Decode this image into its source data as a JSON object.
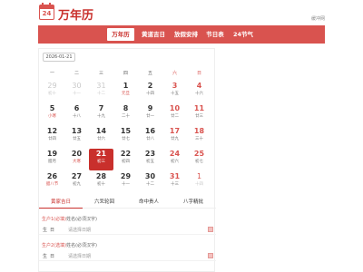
{
  "header": {
    "logo_text": "24",
    "title": "万年历",
    "top_right": "缓冲网"
  },
  "nav": [
    {
      "label": "万年历",
      "active": true
    },
    {
      "label": "黄道吉日",
      "active": false
    },
    {
      "label": "放假安排",
      "active": false
    },
    {
      "label": "节日表",
      "active": false
    },
    {
      "label": "24节气",
      "active": false
    }
  ],
  "date_input": "2026-01-21",
  "weekdays": [
    "一",
    "二",
    "三",
    "四",
    "五",
    "六",
    "日"
  ],
  "calendar": [
    [
      {
        "d": "29",
        "l": "初十",
        "m": true
      },
      {
        "d": "30",
        "l": "十一",
        "m": true
      },
      {
        "d": "31",
        "l": "十二",
        "m": true
      },
      {
        "d": "1",
        "l": "元旦",
        "r": true
      },
      {
        "d": "2",
        "l": "十四"
      },
      {
        "d": "3",
        "l": "十五"
      },
      {
        "d": "4",
        "l": "十六"
      }
    ],
    [
      {
        "d": "5",
        "l": "小寒",
        "r": true
      },
      {
        "d": "6",
        "l": "十八"
      },
      {
        "d": "7",
        "l": "十九"
      },
      {
        "d": "8",
        "l": "二十"
      },
      {
        "d": "9",
        "l": "廿一"
      },
      {
        "d": "10",
        "l": "廿二"
      },
      {
        "d": "11",
        "l": "廿三"
      }
    ],
    [
      {
        "d": "12",
        "l": "廿四"
      },
      {
        "d": "13",
        "l": "廿五"
      },
      {
        "d": "14",
        "l": "廿六"
      },
      {
        "d": "15",
        "l": "廿七"
      },
      {
        "d": "16",
        "l": "廿八"
      },
      {
        "d": "17",
        "l": "廿九"
      },
      {
        "d": "18",
        "l": "三十"
      }
    ],
    [
      {
        "d": "19",
        "l": "腊月"
      },
      {
        "d": "20",
        "l": "大寒",
        "r": true
      },
      {
        "d": "21",
        "l": "初三",
        "today": true
      },
      {
        "d": "22",
        "l": "初四"
      },
      {
        "d": "23",
        "l": "初五"
      },
      {
        "d": "24",
        "l": "初六"
      },
      {
        "d": "25",
        "l": "初七"
      }
    ],
    [
      {
        "d": "26",
        "l": "腊八节",
        "r": true
      },
      {
        "d": "27",
        "l": "初九"
      },
      {
        "d": "28",
        "l": "初十"
      },
      {
        "d": "29",
        "l": "十一"
      },
      {
        "d": "30",
        "l": "十二"
      },
      {
        "d": "31",
        "l": "十三"
      },
      {
        "d": "1",
        "l": "十四",
        "m": true
      }
    ]
  ],
  "tabs": [
    {
      "label": "黄家吉日",
      "active": true
    },
    {
      "label": "六爻轮回",
      "active": false
    },
    {
      "label": "命中贵人",
      "active": false
    },
    {
      "label": "八字精批",
      "active": false
    }
  ],
  "form": {
    "person1": {
      "label": "生户1(必填)",
      "sub": "姓名(必须汉字)"
    },
    "person2": {
      "label": "生户2(选填)",
      "sub": "姓名(必须汉字)"
    },
    "birth_label": "生日",
    "birth_placeholder": "请选择日期"
  }
}
